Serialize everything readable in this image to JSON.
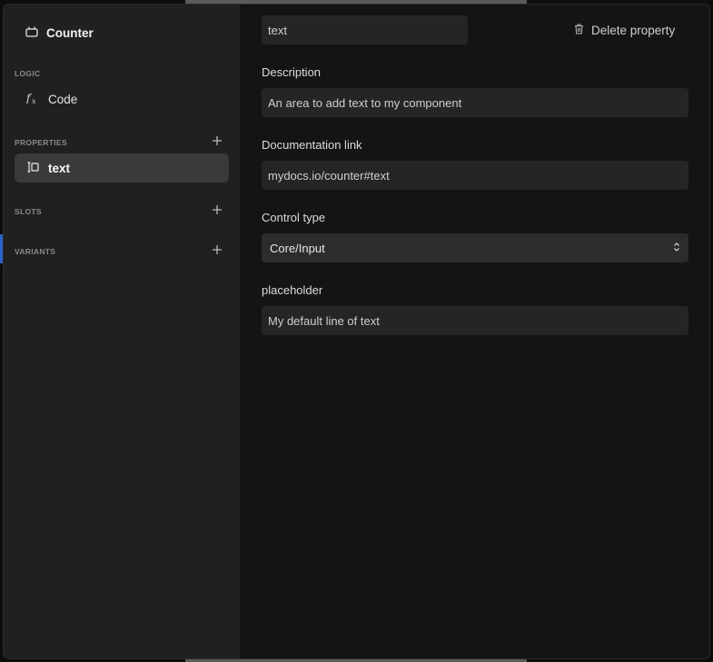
{
  "sidebar": {
    "component_title": "Counter",
    "sections": {
      "logic": "LOGIC",
      "properties": "PROPERTIES",
      "slots": "SLOTS",
      "variants": "VARIANTS"
    },
    "logic_item": "Code",
    "property_item": "text"
  },
  "main": {
    "property_name_value": "text",
    "delete_label": "Delete property",
    "description_label": "Description",
    "description_value": "An area to add text to my component",
    "doc_link_label": "Documentation link",
    "doc_link_value": "mydocs.io/counter#text",
    "control_type_label": "Control type",
    "control_type_value": "Core/Input",
    "placeholder_label": "placeholder",
    "placeholder_value": "My default line of text"
  },
  "colors": {
    "active_row": "#3a3a3a",
    "sidebar_bg": "#202020",
    "panel_bg": "#141414"
  },
  "icons": {
    "component": "component-icon",
    "code": "function-fx-icon",
    "property": "text-property-icon",
    "add": "plus-icon",
    "delete": "trash-icon",
    "select": "chevron-updown-icon"
  }
}
